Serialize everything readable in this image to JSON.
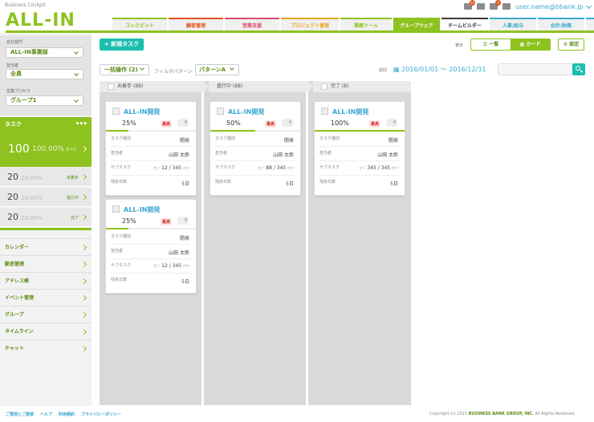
{
  "header": {
    "subtitle": "Business Cockpit",
    "logo": "ALL-IN",
    "user": "user.name@bbank.jp",
    "notif_counts": [
      "12",
      "4"
    ]
  },
  "tabs": [
    "コックピット",
    "顧客管理",
    "営業支援",
    "プロジェクト管理",
    "業務ツール",
    "グループウェア",
    "チームビルダー",
    "人事/給与",
    "会計/財務",
    "販売/仕入/在庫"
  ],
  "tab_colors": [
    "#8dc21f",
    "#e0531e",
    "#e04a6a",
    "#e0a81e",
    "#8dc21f",
    "#8dc21f",
    "#3a3a3a",
    "#3aa8d0",
    "#3aa8d0",
    "#3aa8d0"
  ],
  "sidebar": {
    "company_label": "自社部門",
    "company_value": "ALL-IN事業部",
    "assignee_label": "担当者",
    "assignee_value": "全員",
    "process_label": "営業プロセス",
    "process_value": "グループ1",
    "task_header": "タスク",
    "task_menu": "•••",
    "total": {
      "count": "100",
      "percent": "100.00%",
      "label": "すべて"
    },
    "stats": [
      {
        "count": "20",
        "percent": "20.00%",
        "label": "未着手"
      },
      {
        "count": "20",
        "percent": "20.00%",
        "label": "進行中"
      },
      {
        "count": "20",
        "percent": "20.00%",
        "label": "完了"
      }
    ],
    "menu": [
      "カレンダー",
      "勤怠管理",
      "アドレス帳",
      "イベント管理",
      "グループ",
      "タイムライン",
      "チャット"
    ]
  },
  "toolbar": {
    "new_task": "+ 新規タスク",
    "view_label": "表示",
    "view_list": "☰ 一覧",
    "view_card": "▦ カード",
    "settings": "⚙ 設定",
    "bulk": "一括操作 (2)",
    "filter_label": "フィルタパターン",
    "pattern": "パターンA",
    "period_label": "期間",
    "period": "▦ 2016/01/01 〜 2016/12/31",
    "search_placeholder": ""
  },
  "columns": [
    {
      "title": "未着手 (88)"
    },
    {
      "title": "進行中 (88)"
    },
    {
      "title": "完了 (8)"
    }
  ],
  "card_labels": {
    "type": "タスク種別",
    "assignee": "担当者",
    "subtask": "サブタスク",
    "days": "残余日数",
    "done": "完了",
    "of": "件中"
  },
  "cards": [
    {
      "title": "ALL-IN開発",
      "percent": "25%",
      "progress": 0.25,
      "priority": "最高",
      "attach": "8",
      "type": "開発",
      "assignee": "山田 太郎",
      "sub_done": "12",
      "sub_total": "345",
      "days": "5日"
    },
    {
      "title": "ALL-IN開発",
      "percent": "25%",
      "progress": 0.25,
      "priority": "最高",
      "attach": "8",
      "type": "開発",
      "assignee": "山田 太郎",
      "sub_done": "12",
      "sub_total": "345",
      "days": "5日"
    },
    {
      "title": "ALL-IN開発",
      "percent": "50%",
      "progress": 0.5,
      "priority": "最高",
      "attach": "8",
      "type": "開発",
      "assignee": "山田 太郎",
      "sub_done": "88",
      "sub_total": "345",
      "days": "5日"
    },
    {
      "title": "ALL-IN開発",
      "percent": "100%",
      "progress": 1.0,
      "priority": "最高",
      "attach": "8",
      "type": "開発",
      "assignee": "山田 太郎",
      "sub_done": "345",
      "sub_total": "345",
      "days": "5日"
    }
  ],
  "footer": {
    "links": [
      "ご質問とご要望",
      "ヘルプ",
      "利用規約",
      "プライバシーポリシー"
    ],
    "copyright_prefix": "Copyright (c) 2015",
    "company": "BUSINESS BANK GROUP, INC.",
    "suffix": "All Rights Reserved."
  }
}
